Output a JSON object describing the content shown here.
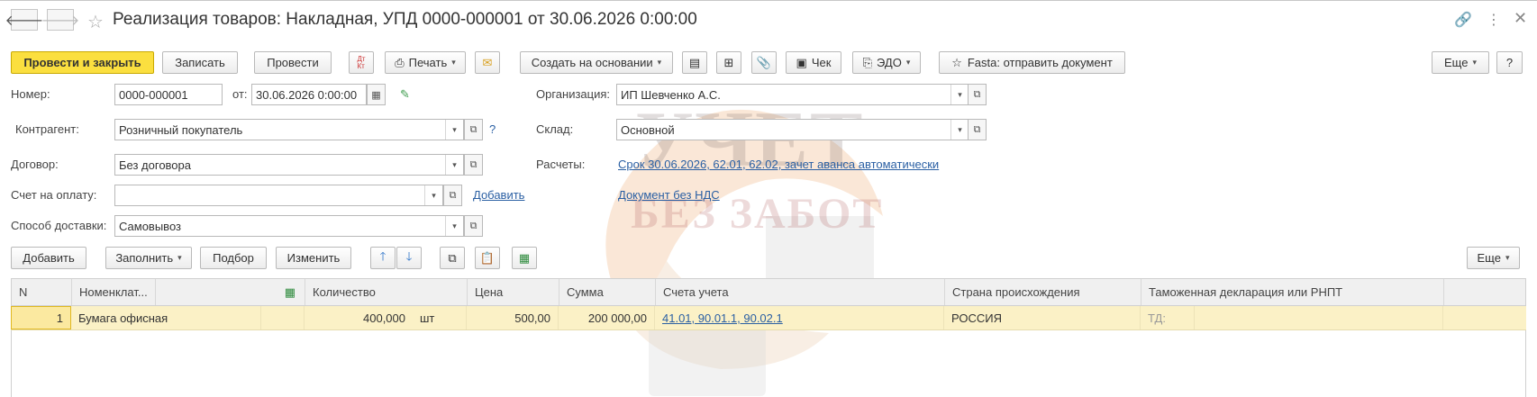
{
  "window": {
    "title": "Реализация товаров: Накладная, УПД 0000-000001 от 30.06.2026 0:00:00",
    "back_icon": "arrow-left-icon",
    "forward_icon": "arrow-right-icon",
    "favorite_icon": "star-icon"
  },
  "toolbar": {
    "post_close": "Провести и закрыть",
    "save": "Записать",
    "post": "Провести",
    "print": "Печать",
    "create_based": "Создать на основании",
    "check": "Чек",
    "edo": "ЭДО",
    "fasta": "Fasta: отправить документ",
    "more": "Еще",
    "help": "?"
  },
  "form": {
    "number_label": "Номер:",
    "number_value": "0000-000001",
    "date_label": "от:",
    "date_value": "30.06.2026  0:00:00",
    "org_label": "Организация:",
    "org_value": "ИП Шевченко А.С.",
    "counterparty_label": "Контрагент:",
    "counterparty_value": "Розничный покупатель",
    "counterparty_help": "?",
    "warehouse_label": "Склад:",
    "warehouse_value": "Основной",
    "contract_label": "Договор:",
    "contract_value": "Без договора",
    "settlements_label": "Расчеты:",
    "settlements_link": "Срок 30.06.2026, 62.01, 62.02, зачет аванса автоматически",
    "invoice_label": "Счет на оплату:",
    "invoice_value": "",
    "invoice_add": "Добавить",
    "vat_link": "Документ без НДС",
    "delivery_label": "Способ доставки:",
    "delivery_value": "Самовывоз"
  },
  "table_toolbar": {
    "add": "Добавить",
    "fill": "Заполнить",
    "pick": "Подбор",
    "change": "Изменить",
    "more": "Еще"
  },
  "table": {
    "headers": [
      "N",
      "Номенклат...",
      "Количество",
      "Цена",
      "Сумма",
      "Счета учета",
      "Страна происхождения",
      "Таможенная декларация или РНПТ"
    ],
    "rows": [
      {
        "n": "1",
        "item": "Бумага офисная",
        "qty": "400,000",
        "unit": "шт",
        "price": "500,00",
        "sum": "200 000,00",
        "accounts": "41.01, 90.01.1, 90.02.1",
        "country": "РОССИЯ",
        "customs": "ТД:"
      }
    ]
  },
  "watermark": {
    "line1": "УЧЕТ",
    "line2": "БЕЗ ЗАБОТ"
  }
}
